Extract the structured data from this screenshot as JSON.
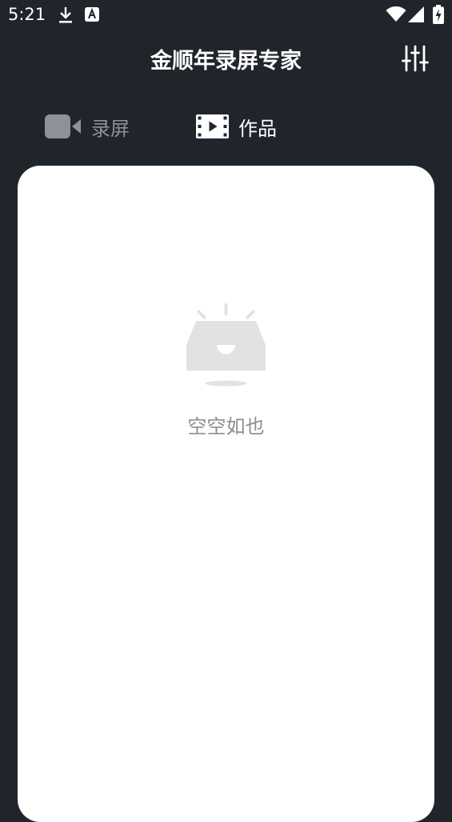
{
  "status_bar": {
    "time": "5:21",
    "icons": [
      "download-icon",
      "keyboard-a-icon",
      "wifi-icon",
      "signal-icon",
      "battery-charging-icon"
    ]
  },
  "header": {
    "title": "金顺年录屏专家",
    "settings_icon": "sliders-icon"
  },
  "tabs": [
    {
      "label": "录屏",
      "icon": "video-camera-icon",
      "active": false
    },
    {
      "label": "作品",
      "icon": "film-icon",
      "active": true
    }
  ],
  "content": {
    "empty_icon": "empty-box-icon",
    "empty_text": "空空如也"
  },
  "colors": {
    "background": "#20242b",
    "card": "#ffffff",
    "inactive_tab": "#8e9196",
    "empty_illustration": "#e2e2e2"
  }
}
